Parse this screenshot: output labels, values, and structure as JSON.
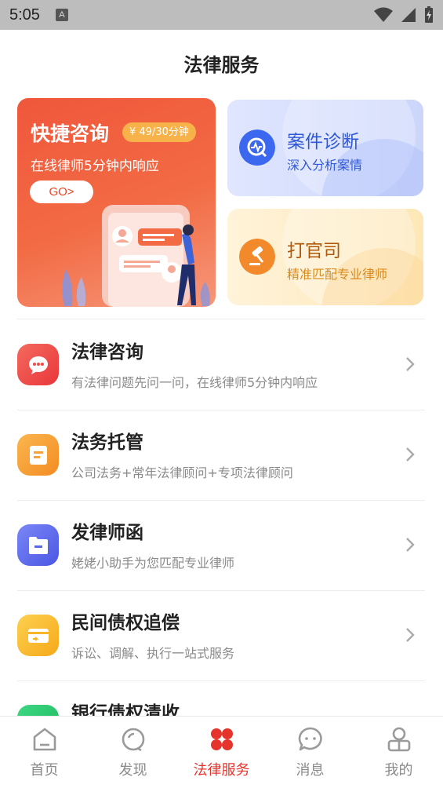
{
  "status_bar": {
    "time": "5:05",
    "notif_letter": "A"
  },
  "header": {
    "title": "法律服务"
  },
  "promo": {
    "quick": {
      "title": "快捷咨询",
      "price": "¥ 49/30分钟",
      "subtitle": "在线律师5分钟内响应",
      "button": "GO>"
    },
    "diagnosis": {
      "title": "案件诊断",
      "subtitle": "深入分析案情"
    },
    "lawsuit": {
      "title": "打官司",
      "subtitle": "精准匹配专业律师"
    }
  },
  "services": [
    {
      "title": "法律咨询",
      "desc": "有法律问题先问一问，在线律师5分钟内响应",
      "icon": "chat-bubble-icon",
      "color": "#ef4d48"
    },
    {
      "title": "法务托管",
      "desc": "公司法务+常年法律顾问+专项法律顾问",
      "icon": "document-icon",
      "color": "#f7a23a"
    },
    {
      "title": "发律师函",
      "desc": "姥姥小助手为您匹配专业律师",
      "icon": "folder-icon",
      "color": "#5a68ec"
    },
    {
      "title": "民间债权追偿",
      "desc": "诉讼、调解、执行一站式服务",
      "icon": "card-icon",
      "color": "#f8b529"
    },
    {
      "title": "银行债权清收",
      "desc": "",
      "icon": "bank-icon",
      "color": "#27c46a"
    }
  ],
  "tabs": [
    {
      "label": "首页",
      "icon": "home-icon"
    },
    {
      "label": "发现",
      "icon": "discover-icon"
    },
    {
      "label": "法律服务",
      "icon": "legal-service-icon",
      "active": true
    },
    {
      "label": "消息",
      "icon": "message-icon"
    },
    {
      "label": "我的",
      "icon": "profile-icon"
    }
  ],
  "colors": {
    "accent": "#e5342b",
    "promo_red": "#f0573b",
    "diag_blue": "#2f58d8",
    "lawsuit_brown": "#b0570a"
  }
}
